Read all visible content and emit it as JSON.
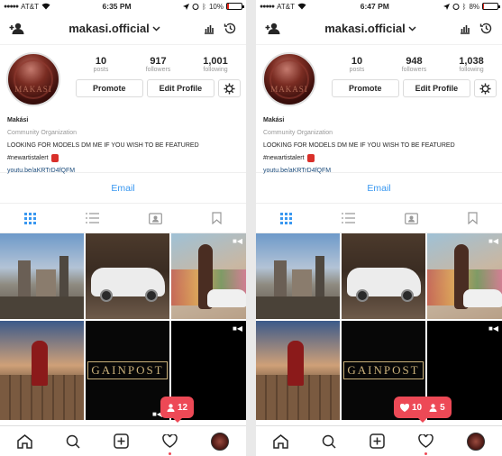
{
  "screens": [
    {
      "status": {
        "carrier": "AT&T",
        "time": "6:35 PM",
        "battery": "10%",
        "battery_level": 0.1
      },
      "header": {
        "username": "makasi.official"
      },
      "stats": [
        {
          "value": "10",
          "label": "posts"
        },
        {
          "value": "917",
          "label": "followers"
        },
        {
          "value": "1,001",
          "label": "following"
        }
      ],
      "buttons": {
        "promote": "Promote",
        "edit_profile": "Edit Profile"
      },
      "bio": {
        "name": "Makási",
        "category": "Community Organization",
        "text": "LOOKING FOR MODELS DM ME IF YOU WISH TO BE FEATURED",
        "hashtag": "#newartistalert",
        "link": "youtu.be/aKRTrD4fQFM"
      },
      "email_label": "Email",
      "grid_text": {
        "gainpost": "GAINPOST"
      },
      "notification": {
        "likes": "",
        "follows": "12"
      }
    },
    {
      "status": {
        "carrier": "AT&T",
        "time": "6:47 PM",
        "battery": "8%",
        "battery_level": 0.08
      },
      "header": {
        "username": "makasi.official"
      },
      "stats": [
        {
          "value": "10",
          "label": "posts"
        },
        {
          "value": "948",
          "label": "followers"
        },
        {
          "value": "1,038",
          "label": "following"
        }
      ],
      "buttons": {
        "promote": "Promote",
        "edit_profile": "Edit Profile"
      },
      "bio": {
        "name": "Makási",
        "category": "Community Organization",
        "text": "LOOKING FOR MODELS DM ME IF YOU WISH TO BE FEATURED",
        "hashtag": "#newartistalert",
        "link": "youtu.be/aKRTrD4fQFM"
      },
      "email_label": "Email",
      "grid_text": {
        "gainpost": "GAINPOST"
      },
      "notification": {
        "likes": "10",
        "follows": "5"
      }
    }
  ],
  "colors": {
    "accent": "#3897f0",
    "notification": "#ed4956",
    "link": "#1a4a7a"
  },
  "icons": [
    "add-person-icon",
    "insights-icon",
    "history-icon",
    "gear-icon",
    "grid-icon",
    "list-icon",
    "tagged-icon",
    "bookmark-icon",
    "home-icon",
    "search-icon",
    "new-post-icon",
    "heart-icon",
    "camera-video-icon"
  ]
}
